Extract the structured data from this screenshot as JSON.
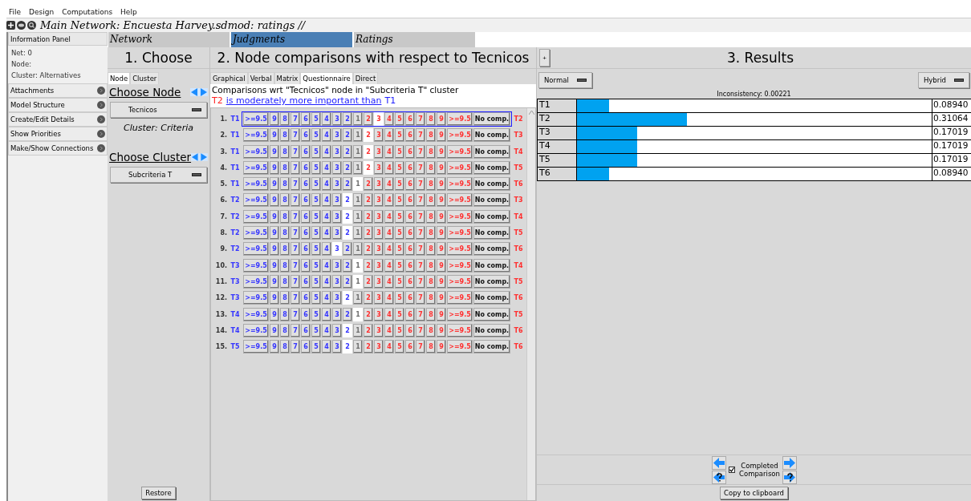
{
  "menu": [
    "File",
    "Design",
    "Computations",
    "Help"
  ],
  "title": "Main Network: Encuesta Harvey.sdmod: ratings //",
  "info_panel": {
    "title": "Information Panel",
    "lines": [
      "Net: 0",
      "Node:",
      "Cluster: Alternatives"
    ]
  },
  "sidebar_items": [
    "Attachments",
    "Model Structure",
    "Create/Edit Details",
    "Show Priorities",
    "Make/Show Connections"
  ],
  "main_tabs": [
    {
      "label": "Network",
      "selected": false
    },
    {
      "label": "Judgments",
      "selected": true
    },
    {
      "label": "Ratings",
      "selected": false
    }
  ],
  "choose": {
    "heading": "1. Choose",
    "tabs": [
      {
        "label": "Node",
        "selected": true
      },
      {
        "label": "Cluster",
        "selected": false
      }
    ],
    "node_heading": "Choose Node",
    "node_value": "Tecnicos",
    "cluster_label": "Cluster: Criteria",
    "cluster_heading": "Choose Cluster",
    "cluster_value": "Subcriteria T",
    "restore": "Restore"
  },
  "comparisons": {
    "heading": "2. Node comparisons with respect to Tecnicos",
    "tabs": [
      {
        "label": "Graphical",
        "selected": false
      },
      {
        "label": "Verbal",
        "selected": false
      },
      {
        "label": "Matrix",
        "selected": false
      },
      {
        "label": "Questionnaire",
        "selected": true
      },
      {
        "label": "Direct",
        "selected": false
      }
    ],
    "caption": "Comparisons wrt \"Tecnicos\" node in \"Subcriteria T\" cluster",
    "statement": {
      "first": "T2",
      "verb": "is moderately more important than",
      "second": "T1"
    },
    "rows": [
      {
        "number": "1.",
        "left": "T1",
        "right": "T2",
        "selected": true,
        "cells": [
          {
            "label": ">=9.5",
            "selected": false
          },
          {
            "label": "9",
            "selected": false
          },
          {
            "label": "8",
            "selected": false
          },
          {
            "label": "7",
            "selected": false
          },
          {
            "label": "6",
            "selected": false
          },
          {
            "label": "5",
            "selected": false
          },
          {
            "label": "4",
            "selected": false
          },
          {
            "label": "3",
            "selected": false
          },
          {
            "label": "2",
            "selected": false
          },
          {
            "label": "1",
            "selected": false
          },
          {
            "label": "2",
            "selected": false
          },
          {
            "label": "3",
            "selected": true
          },
          {
            "label": "4",
            "selected": false
          },
          {
            "label": "5",
            "selected": false
          },
          {
            "label": "6",
            "selected": false
          },
          {
            "label": "7",
            "selected": false
          },
          {
            "label": "8",
            "selected": false
          },
          {
            "label": "9",
            "selected": false
          },
          {
            "label": ">=9.5",
            "selected": false
          },
          {
            "label": "No comp.",
            "selected": false
          }
        ]
      },
      {
        "number": "2.",
        "left": "T1",
        "right": "T3",
        "selected": false,
        "cells": [
          {
            "label": ">=9.5",
            "selected": false
          },
          {
            "label": "9",
            "selected": false
          },
          {
            "label": "8",
            "selected": false
          },
          {
            "label": "7",
            "selected": false
          },
          {
            "label": "6",
            "selected": false
          },
          {
            "label": "5",
            "selected": false
          },
          {
            "label": "4",
            "selected": false
          },
          {
            "label": "3",
            "selected": false
          },
          {
            "label": "2",
            "selected": false
          },
          {
            "label": "1",
            "selected": false
          },
          {
            "label": "2",
            "selected": true
          },
          {
            "label": "3",
            "selected": false
          },
          {
            "label": "4",
            "selected": false
          },
          {
            "label": "5",
            "selected": false
          },
          {
            "label": "6",
            "selected": false
          },
          {
            "label": "7",
            "selected": false
          },
          {
            "label": "8",
            "selected": false
          },
          {
            "label": "9",
            "selected": false
          },
          {
            "label": ">=9.5",
            "selected": false
          },
          {
            "label": "No comp.",
            "selected": false
          }
        ]
      },
      {
        "number": "3.",
        "left": "T1",
        "right": "T4",
        "selected": false,
        "cells": [
          {
            "label": ">=9.5",
            "selected": false
          },
          {
            "label": "9",
            "selected": false
          },
          {
            "label": "8",
            "selected": false
          },
          {
            "label": "7",
            "selected": false
          },
          {
            "label": "6",
            "selected": false
          },
          {
            "label": "5",
            "selected": false
          },
          {
            "label": "4",
            "selected": false
          },
          {
            "label": "3",
            "selected": false
          },
          {
            "label": "2",
            "selected": false
          },
          {
            "label": "1",
            "selected": false
          },
          {
            "label": "2",
            "selected": true
          },
          {
            "label": "3",
            "selected": false
          },
          {
            "label": "4",
            "selected": false
          },
          {
            "label": "5",
            "selected": false
          },
          {
            "label": "6",
            "selected": false
          },
          {
            "label": "7",
            "selected": false
          },
          {
            "label": "8",
            "selected": false
          },
          {
            "label": "9",
            "selected": false
          },
          {
            "label": ">=9.5",
            "selected": false
          },
          {
            "label": "No comp.",
            "selected": false
          }
        ]
      },
      {
        "number": "4.",
        "left": "T1",
        "right": "T5",
        "selected": false,
        "cells": [
          {
            "label": ">=9.5",
            "selected": false
          },
          {
            "label": "9",
            "selected": false
          },
          {
            "label": "8",
            "selected": false
          },
          {
            "label": "7",
            "selected": false
          },
          {
            "label": "6",
            "selected": false
          },
          {
            "label": "5",
            "selected": false
          },
          {
            "label": "4",
            "selected": false
          },
          {
            "label": "3",
            "selected": false
          },
          {
            "label": "2",
            "selected": false
          },
          {
            "label": "1",
            "selected": false
          },
          {
            "label": "2",
            "selected": true
          },
          {
            "label": "3",
            "selected": false
          },
          {
            "label": "4",
            "selected": false
          },
          {
            "label": "5",
            "selected": false
          },
          {
            "label": "6",
            "selected": false
          },
          {
            "label": "7",
            "selected": false
          },
          {
            "label": "8",
            "selected": false
          },
          {
            "label": "9",
            "selected": false
          },
          {
            "label": ">=9.5",
            "selected": false
          },
          {
            "label": "No comp.",
            "selected": false
          }
        ]
      },
      {
        "number": "5.",
        "left": "T1",
        "right": "T6",
        "selected": false,
        "cells": [
          {
            "label": ">=9.5",
            "selected": false
          },
          {
            "label": "9",
            "selected": false
          },
          {
            "label": "8",
            "selected": false
          },
          {
            "label": "7",
            "selected": false
          },
          {
            "label": "6",
            "selected": false
          },
          {
            "label": "5",
            "selected": false
          },
          {
            "label": "4",
            "selected": false
          },
          {
            "label": "3",
            "selected": false
          },
          {
            "label": "2",
            "selected": false
          },
          {
            "label": "1",
            "selected": true
          },
          {
            "label": "2",
            "selected": false
          },
          {
            "label": "3",
            "selected": false
          },
          {
            "label": "4",
            "selected": false
          },
          {
            "label": "5",
            "selected": false
          },
          {
            "label": "6",
            "selected": false
          },
          {
            "label": "7",
            "selected": false
          },
          {
            "label": "8",
            "selected": false
          },
          {
            "label": "9",
            "selected": false
          },
          {
            "label": ">=9.5",
            "selected": false
          },
          {
            "label": "No comp.",
            "selected": false
          }
        ]
      },
      {
        "number": "6.",
        "left": "T2",
        "right": "T3",
        "selected": false,
        "cells": [
          {
            "label": ">=9.5",
            "selected": false
          },
          {
            "label": "9",
            "selected": false
          },
          {
            "label": "8",
            "selected": false
          },
          {
            "label": "7",
            "selected": false
          },
          {
            "label": "6",
            "selected": false
          },
          {
            "label": "5",
            "selected": false
          },
          {
            "label": "4",
            "selected": false
          },
          {
            "label": "3",
            "selected": false
          },
          {
            "label": "2",
            "selected": true
          },
          {
            "label": "1",
            "selected": false
          },
          {
            "label": "2",
            "selected": false
          },
          {
            "label": "3",
            "selected": false
          },
          {
            "label": "4",
            "selected": false
          },
          {
            "label": "5",
            "selected": false
          },
          {
            "label": "6",
            "selected": false
          },
          {
            "label": "7",
            "selected": false
          },
          {
            "label": "8",
            "selected": false
          },
          {
            "label": "9",
            "selected": false
          },
          {
            "label": ">=9.5",
            "selected": false
          },
          {
            "label": "No comp.",
            "selected": false
          }
        ]
      },
      {
        "number": "7.",
        "left": "T2",
        "right": "T4",
        "selected": false,
        "cells": [
          {
            "label": ">=9.5",
            "selected": false
          },
          {
            "label": "9",
            "selected": false
          },
          {
            "label": "8",
            "selected": false
          },
          {
            "label": "7",
            "selected": false
          },
          {
            "label": "6",
            "selected": false
          },
          {
            "label": "5",
            "selected": false
          },
          {
            "label": "4",
            "selected": false
          },
          {
            "label": "3",
            "selected": false
          },
          {
            "label": "2",
            "selected": true
          },
          {
            "label": "1",
            "selected": false
          },
          {
            "label": "2",
            "selected": false
          },
          {
            "label": "3",
            "selected": false
          },
          {
            "label": "4",
            "selected": false
          },
          {
            "label": "5",
            "selected": false
          },
          {
            "label": "6",
            "selected": false
          },
          {
            "label": "7",
            "selected": false
          },
          {
            "label": "8",
            "selected": false
          },
          {
            "label": "9",
            "selected": false
          },
          {
            "label": ">=9.5",
            "selected": false
          },
          {
            "label": "No comp.",
            "selected": false
          }
        ]
      },
      {
        "number": "8.",
        "left": "T2",
        "right": "T5",
        "selected": false,
        "cells": [
          {
            "label": ">=9.5",
            "selected": false
          },
          {
            "label": "9",
            "selected": false
          },
          {
            "label": "8",
            "selected": false
          },
          {
            "label": "7",
            "selected": false
          },
          {
            "label": "6",
            "selected": false
          },
          {
            "label": "5",
            "selected": false
          },
          {
            "label": "4",
            "selected": false
          },
          {
            "label": "3",
            "selected": false
          },
          {
            "label": "2",
            "selected": true
          },
          {
            "label": "1",
            "selected": false
          },
          {
            "label": "2",
            "selected": false
          },
          {
            "label": "3",
            "selected": false
          },
          {
            "label": "4",
            "selected": false
          },
          {
            "label": "5",
            "selected": false
          },
          {
            "label": "6",
            "selected": false
          },
          {
            "label": "7",
            "selected": false
          },
          {
            "label": "8",
            "selected": false
          },
          {
            "label": "9",
            "selected": false
          },
          {
            "label": ">=9.5",
            "selected": false
          },
          {
            "label": "No comp.",
            "selected": false
          }
        ]
      },
      {
        "number": "9.",
        "left": "T2",
        "right": "T6",
        "selected": false,
        "cells": [
          {
            "label": ">=9.5",
            "selected": false
          },
          {
            "label": "9",
            "selected": false
          },
          {
            "label": "8",
            "selected": false
          },
          {
            "label": "7",
            "selected": false
          },
          {
            "label": "6",
            "selected": false
          },
          {
            "label": "5",
            "selected": false
          },
          {
            "label": "4",
            "selected": false
          },
          {
            "label": "3",
            "selected": true
          },
          {
            "label": "2",
            "selected": false
          },
          {
            "label": "1",
            "selected": false
          },
          {
            "label": "2",
            "selected": false
          },
          {
            "label": "3",
            "selected": false
          },
          {
            "label": "4",
            "selected": false
          },
          {
            "label": "5",
            "selected": false
          },
          {
            "label": "6",
            "selected": false
          },
          {
            "label": "7",
            "selected": false
          },
          {
            "label": "8",
            "selected": false
          },
          {
            "label": "9",
            "selected": false
          },
          {
            "label": ">=9.5",
            "selected": false
          },
          {
            "label": "No comp.",
            "selected": false
          }
        ]
      },
      {
        "number": "10.",
        "left": "T3",
        "right": "T4",
        "selected": false,
        "cells": [
          {
            "label": ">=9.5",
            "selected": false
          },
          {
            "label": "9",
            "selected": false
          },
          {
            "label": "8",
            "selected": false
          },
          {
            "label": "7",
            "selected": false
          },
          {
            "label": "6",
            "selected": false
          },
          {
            "label": "5",
            "selected": false
          },
          {
            "label": "4",
            "selected": false
          },
          {
            "label": "3",
            "selected": false
          },
          {
            "label": "2",
            "selected": false
          },
          {
            "label": "1",
            "selected": true
          },
          {
            "label": "2",
            "selected": false
          },
          {
            "label": "3",
            "selected": false
          },
          {
            "label": "4",
            "selected": false
          },
          {
            "label": "5",
            "selected": false
          },
          {
            "label": "6",
            "selected": false
          },
          {
            "label": "7",
            "selected": false
          },
          {
            "label": "8",
            "selected": false
          },
          {
            "label": "9",
            "selected": false
          },
          {
            "label": ">=9.5",
            "selected": false
          },
          {
            "label": "No comp.",
            "selected": false
          }
        ]
      },
      {
        "number": "11.",
        "left": "T3",
        "right": "T5",
        "selected": false,
        "cells": [
          {
            "label": ">=9.5",
            "selected": false
          },
          {
            "label": "9",
            "selected": false
          },
          {
            "label": "8",
            "selected": false
          },
          {
            "label": "7",
            "selected": false
          },
          {
            "label": "6",
            "selected": false
          },
          {
            "label": "5",
            "selected": false
          },
          {
            "label": "4",
            "selected": false
          },
          {
            "label": "3",
            "selected": false
          },
          {
            "label": "2",
            "selected": false
          },
          {
            "label": "1",
            "selected": true
          },
          {
            "label": "2",
            "selected": false
          },
          {
            "label": "3",
            "selected": false
          },
          {
            "label": "4",
            "selected": false
          },
          {
            "label": "5",
            "selected": false
          },
          {
            "label": "6",
            "selected": false
          },
          {
            "label": "7",
            "selected": false
          },
          {
            "label": "8",
            "selected": false
          },
          {
            "label": "9",
            "selected": false
          },
          {
            "label": ">=9.5",
            "selected": false
          },
          {
            "label": "No comp.",
            "selected": false
          }
        ]
      },
      {
        "number": "12.",
        "left": "T3",
        "right": "T6",
        "selected": false,
        "cells": [
          {
            "label": ">=9.5",
            "selected": false
          },
          {
            "label": "9",
            "selected": false
          },
          {
            "label": "8",
            "selected": false
          },
          {
            "label": "7",
            "selected": false
          },
          {
            "label": "6",
            "selected": false
          },
          {
            "label": "5",
            "selected": false
          },
          {
            "label": "4",
            "selected": false
          },
          {
            "label": "3",
            "selected": false
          },
          {
            "label": "2",
            "selected": true
          },
          {
            "label": "1",
            "selected": false
          },
          {
            "label": "2",
            "selected": false
          },
          {
            "label": "3",
            "selected": false
          },
          {
            "label": "4",
            "selected": false
          },
          {
            "label": "5",
            "selected": false
          },
          {
            "label": "6",
            "selected": false
          },
          {
            "label": "7",
            "selected": false
          },
          {
            "label": "8",
            "selected": false
          },
          {
            "label": "9",
            "selected": false
          },
          {
            "label": ">=9.5",
            "selected": false
          },
          {
            "label": "No comp.",
            "selected": false
          }
        ]
      },
      {
        "number": "13.",
        "left": "T4",
        "right": "T5",
        "selected": false,
        "cells": [
          {
            "label": ">=9.5",
            "selected": false
          },
          {
            "label": "9",
            "selected": false
          },
          {
            "label": "8",
            "selected": false
          },
          {
            "label": "7",
            "selected": false
          },
          {
            "label": "6",
            "selected": false
          },
          {
            "label": "5",
            "selected": false
          },
          {
            "label": "4",
            "selected": false
          },
          {
            "label": "3",
            "selected": false
          },
          {
            "label": "2",
            "selected": false
          },
          {
            "label": "1",
            "selected": true
          },
          {
            "label": "2",
            "selected": false
          },
          {
            "label": "3",
            "selected": false
          },
          {
            "label": "4",
            "selected": false
          },
          {
            "label": "5",
            "selected": false
          },
          {
            "label": "6",
            "selected": false
          },
          {
            "label": "7",
            "selected": false
          },
          {
            "label": "8",
            "selected": false
          },
          {
            "label": "9",
            "selected": false
          },
          {
            "label": ">=9.5",
            "selected": false
          },
          {
            "label": "No comp.",
            "selected": false
          }
        ]
      },
      {
        "number": "14.",
        "left": "T4",
        "right": "T6",
        "selected": false,
        "cells": [
          {
            "label": ">=9.5",
            "selected": false
          },
          {
            "label": "9",
            "selected": false
          },
          {
            "label": "8",
            "selected": false
          },
          {
            "label": "7",
            "selected": false
          },
          {
            "label": "6",
            "selected": false
          },
          {
            "label": "5",
            "selected": false
          },
          {
            "label": "4",
            "selected": false
          },
          {
            "label": "3",
            "selected": false
          },
          {
            "label": "2",
            "selected": true
          },
          {
            "label": "1",
            "selected": false
          },
          {
            "label": "2",
            "selected": false
          },
          {
            "label": "3",
            "selected": false
          },
          {
            "label": "4",
            "selected": false
          },
          {
            "label": "5",
            "selected": false
          },
          {
            "label": "6",
            "selected": false
          },
          {
            "label": "7",
            "selected": false
          },
          {
            "label": "8",
            "selected": false
          },
          {
            "label": "9",
            "selected": false
          },
          {
            "label": ">=9.5",
            "selected": false
          },
          {
            "label": "No comp.",
            "selected": false
          }
        ]
      },
      {
        "number": "15.",
        "left": "T5",
        "right": "T6",
        "selected": false,
        "cells": [
          {
            "label": ">=9.5",
            "selected": false
          },
          {
            "label": "9",
            "selected": false
          },
          {
            "label": "8",
            "selected": false
          },
          {
            "label": "7",
            "selected": false
          },
          {
            "label": "6",
            "selected": false
          },
          {
            "label": "5",
            "selected": false
          },
          {
            "label": "4",
            "selected": false
          },
          {
            "label": "3",
            "selected": false
          },
          {
            "label": "2",
            "selected": true
          },
          {
            "label": "1",
            "selected": false
          },
          {
            "label": "2",
            "selected": false
          },
          {
            "label": "3",
            "selected": false
          },
          {
            "label": "4",
            "selected": false
          },
          {
            "label": "5",
            "selected": false
          },
          {
            "label": "6",
            "selected": false
          },
          {
            "label": "7",
            "selected": false
          },
          {
            "label": "8",
            "selected": false
          },
          {
            "label": "9",
            "selected": false
          },
          {
            "label": ">=9.5",
            "selected": false
          },
          {
            "label": "No comp.",
            "selected": false
          }
        ]
      }
    ]
  },
  "results": {
    "add": "+",
    "heading": "3. Results",
    "mode": "Normal",
    "method": "Hybrid",
    "inconsistency": "Inconsistency: 0.00221",
    "items": [
      {
        "label": "T1",
        "level": 0.0894,
        "value": "0.08940"
      },
      {
        "label": "T2",
        "level": 0.31064,
        "value": "0.31064"
      },
      {
        "label": "T3",
        "level": 0.17019,
        "value": "0.17019"
      },
      {
        "label": "T4",
        "level": 0.17019,
        "value": "0.17019"
      },
      {
        "label": "T5",
        "level": 0.17019,
        "value": "0.17019"
      },
      {
        "label": "T6",
        "level": 0.0894,
        "value": "0.08940"
      }
    ],
    "completed": {
      "checked": true,
      "label": "Completed Comparison"
    },
    "copy": "Copy to clipboard"
  }
}
